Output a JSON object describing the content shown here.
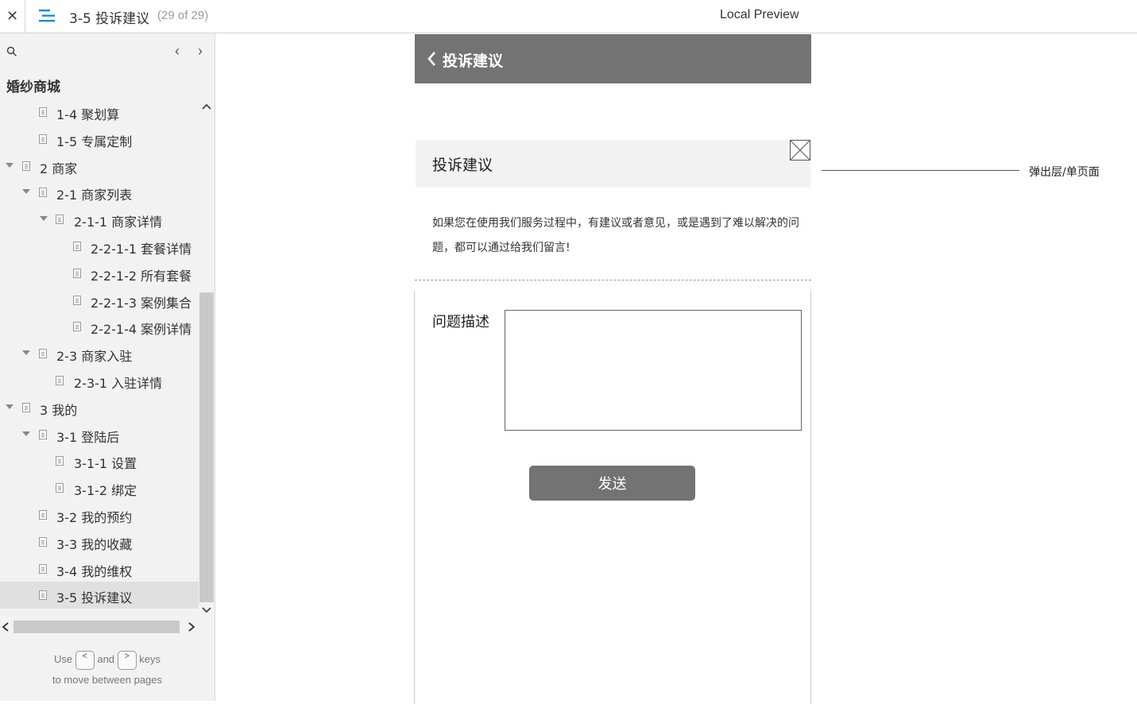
{
  "topbar": {
    "close_glyph": "✕",
    "menu_icon": "menu-icon",
    "page_title": "3-5 投诉建议",
    "page_count": "(29 of 29)",
    "preview_title": "Local Preview",
    "accent_color": "#1a8ad4"
  },
  "sidebar": {
    "search_icon": "search-icon",
    "prev_glyph": "‹",
    "next_glyph": "›",
    "project_name": "婚纱商城",
    "items": [
      {
        "label": "1-4 聚划算",
        "level": 2,
        "expanded": false,
        "selected": false
      },
      {
        "label": "1-5 专属定制",
        "level": 2,
        "expanded": false,
        "selected": false
      },
      {
        "label": "2 商家",
        "level": 1,
        "expanded": true,
        "selected": false
      },
      {
        "label": "2-1 商家列表",
        "level": 2,
        "expanded": true,
        "selected": false
      },
      {
        "label": "2-1-1 商家详情",
        "level": 3,
        "expanded": true,
        "selected": false
      },
      {
        "label": "2-2-1-1 套餐详情",
        "level": 4,
        "expanded": false,
        "selected": false
      },
      {
        "label": "2-2-1-2 所有套餐",
        "level": 4,
        "expanded": false,
        "selected": false
      },
      {
        "label": "2-2-1-3 案例集合",
        "level": 4,
        "expanded": false,
        "selected": false
      },
      {
        "label": "2-2-1-4 案例详情",
        "level": 4,
        "expanded": false,
        "selected": false
      },
      {
        "label": "2-3 商家入驻",
        "level": 2,
        "expanded": true,
        "selected": false
      },
      {
        "label": "2-3-1 入驻详情",
        "level": 3,
        "expanded": false,
        "selected": false
      },
      {
        "label": "3 我的",
        "level": 1,
        "expanded": true,
        "selected": false
      },
      {
        "label": "3-1 登陆后",
        "level": 2,
        "expanded": true,
        "selected": false
      },
      {
        "label": "3-1-1 设置",
        "level": 3,
        "expanded": false,
        "selected": false
      },
      {
        "label": "3-1-2 绑定",
        "level": 3,
        "expanded": false,
        "selected": false
      },
      {
        "label": "3-2 我的预约",
        "level": 2,
        "expanded": false,
        "selected": false
      },
      {
        "label": "3-3 我的收藏",
        "level": 2,
        "expanded": false,
        "selected": false
      },
      {
        "label": "3-4 我的维权",
        "level": 2,
        "expanded": false,
        "selected": false
      },
      {
        "label": "3-5 投诉建议",
        "level": 2,
        "expanded": false,
        "selected": true
      }
    ],
    "hint": {
      "use": "Use",
      "key_prev": "<",
      "and": "and",
      "key_next": ">",
      "keys": "keys",
      "line2": "to move between pages"
    }
  },
  "content": {
    "header_title": "投诉建议",
    "header_color": "#737373",
    "popup_title": "投诉建议",
    "annotation": "弹出层/单页面",
    "description": "如果您在使用我们服务过程中，有建议或者意见，或是遇到了难以解决的问题，都可以通过给我们留言!",
    "field_label": "问题描述",
    "textarea_value": "",
    "send_label": "发送"
  }
}
